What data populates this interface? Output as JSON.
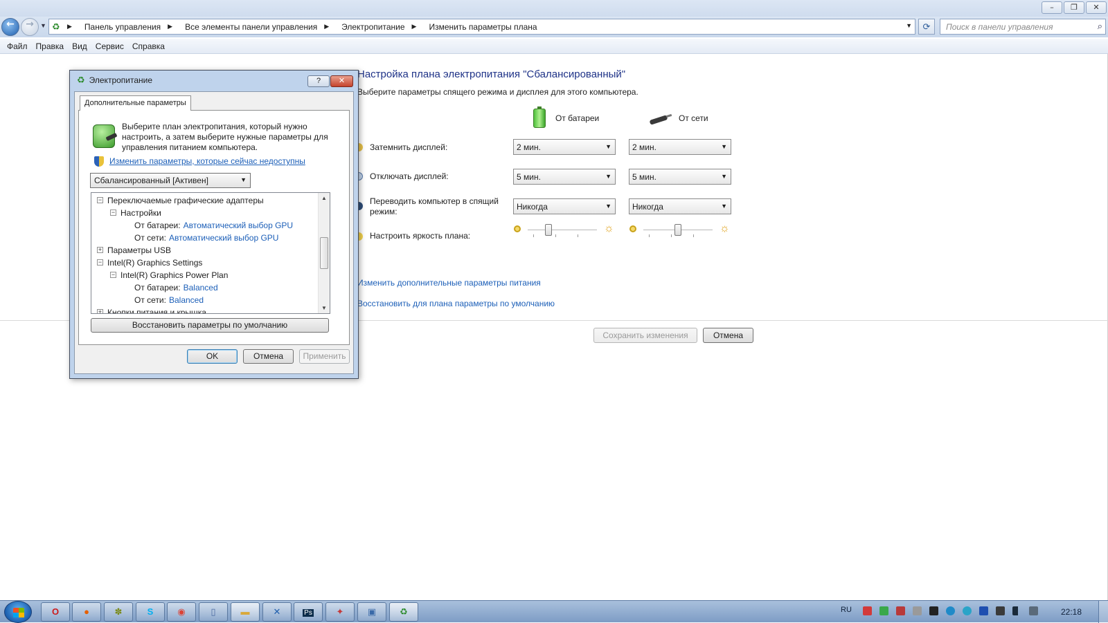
{
  "window": {
    "minimize": "–",
    "restore": "❐",
    "close": "✕"
  },
  "address": {
    "crumbs": [
      "Панель управления",
      "Все элементы панели управления",
      "Электропитание",
      "Изменить параметры плана"
    ],
    "search_placeholder": "Поиск в панели управления"
  },
  "menu": [
    "Файл",
    "Правка",
    "Вид",
    "Сервис",
    "Справка"
  ],
  "main": {
    "heading": "Настройка плана электропитания \"Сбалансированный\"",
    "subheading": "Выберите параметры спящего режима и дисплея для этого компьютера.",
    "col_battery": "От батареи",
    "col_ac": "От сети",
    "rows": [
      {
        "label": "Затемнить дисплей:",
        "battery": "2 мин.",
        "ac": "2 мин."
      },
      {
        "label": "Отключать дисплей:",
        "battery": "5 мин.",
        "ac": "5 мин."
      },
      {
        "label": "Переводить компьютер в спящий режим:",
        "battery": "Никогда",
        "ac": "Никогда"
      }
    ],
    "brightness_label": "Настроить яркость плана:",
    "brightness_battery": 0.3,
    "brightness_ac": 0.5,
    "link_advanced": "Изменить дополнительные параметры питания",
    "link_restore": "Восстановить для плана параметры по умолчанию",
    "save": "Сохранить изменения",
    "cancel": "Отмена"
  },
  "dialog": {
    "title": "Электропитание",
    "help": "?",
    "close": "✕",
    "tab": "Дополнительные параметры",
    "description": "Выберите план электропитания, который нужно настроить, а затем выберите нужные параметры для управления питанием компьютера.",
    "link": "Изменить параметры, которые сейчас недоступны",
    "plan": "Сбалансированный [Активен]",
    "tree": {
      "switchable": "Переключаемые графические адаптеры",
      "settings": "Настройки",
      "battery_label": "От батареи:",
      "battery_value": "Автоматический выбор GPU",
      "ac_label": "От сети:",
      "ac_value": "Автоматический выбор GPU",
      "usb": "Параметры USB",
      "intel": "Intel(R) Graphics Settings",
      "intel_plan": "Intel(R) Graphics Power Plan",
      "intel_battery_label": "От батареи:",
      "intel_battery_value": "Balanced",
      "intel_ac_label": "От сети:",
      "intel_ac_value": "Balanced",
      "buttons": "Кнопки питания и крышка"
    },
    "restore": "Восстановить параметры по умолчанию",
    "ok": "OK",
    "cancel": "Отмена",
    "apply": "Применить"
  },
  "taskbar": {
    "lang": "RU",
    "time": "22:18",
    "items": [
      "opera-icon",
      "firefox-icon",
      "bug-icon",
      "skype-icon",
      "chrome-icon",
      "document-icon",
      "folder-icon",
      "app-icon",
      "photoshop-icon",
      "tool-icon",
      "monitor-icon",
      "power-options-icon"
    ]
  }
}
